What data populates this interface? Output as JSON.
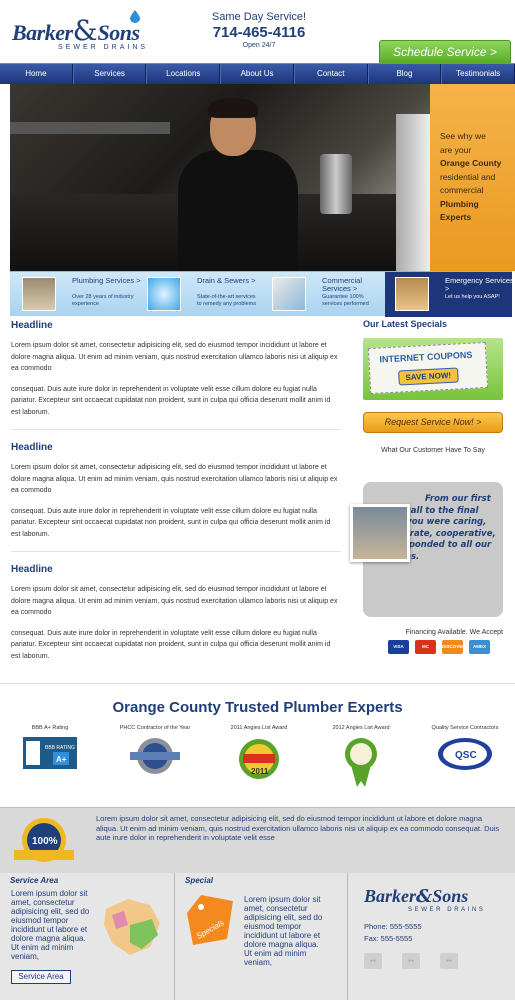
{
  "header": {
    "brand_first": "Barker",
    "brand_amp": "&",
    "brand_second": "Sons",
    "brand_sub": "SEWER DRAINS",
    "service_line": "Same Day Service!",
    "phone": "714-465-4116",
    "hours": "Open 24/7",
    "schedule_label": "Schedule Service >"
  },
  "nav": {
    "items": [
      "Home",
      "Services",
      "Locations",
      "About Us",
      "Contact",
      "Blog",
      "Testimonials"
    ]
  },
  "hero": {
    "promo_line1": "See why we",
    "promo_line2": "are your",
    "promo_line3": "Orange County",
    "promo_line4": "residential and",
    "promo_line5": "commercial",
    "promo_line6": "Plumbing",
    "promo_line7": "Experts"
  },
  "services": [
    {
      "title": "Plumbing Services >",
      "desc": "Over 28 years of industry experience"
    },
    {
      "title": "Drain & Sewers >",
      "desc": "State-of-the-art services to remedy any problems"
    },
    {
      "title": "Commercial Services >",
      "desc": "Guarantee 100% services performed"
    },
    {
      "title": "Emergency Services >",
      "desc": "Let us help you ASAP!"
    }
  ],
  "articles": [
    {
      "headline": "Headline",
      "p1": "Lorem ipsum dolor sit amet, consectetur adipisicing elit, sed do eiusmod tempor incididunt ut labore et dolore magna aliqua. Ut enim ad minim veniam, quis nostrud exercitation ullamco laboris nisi ut aliquip ex ea commodo",
      "p2": "consequat. Duis aute irure dolor in reprehenderit in voluptate velit esse cillum dolore eu fugiat nulla pariatur. Excepteur sint occaecat cupidatat non proident, sunt in culpa qui officia deserunt mollit anim id est laborum."
    },
    {
      "headline": "Headline",
      "p1": "Lorem ipsum dolor sit amet, consectetur adipisicing elit, sed do eiusmod tempor incididunt ut labore et dolore magna aliqua. Ut enim ad minim veniam, quis nostrud exercitation ullamco laboris nisi ut aliquip ex ea commodo",
      "p2": "consequat. Duis aute irure dolor in reprehenderit in voluptate velit esse cillum dolore eu fugiat nulla pariatur. Excepteur sint occaecat cupidatat non proident, sunt in culpa qui officia deserunt mollit anim id est laborum."
    },
    {
      "headline": "Headline",
      "p1": "Lorem ipsum dolor sit amet, consectetur adipisicing elit, sed do eiusmod tempor incididunt ut labore et dolore magna aliqua. Ut enim ad minim veniam, quis nostrud exercitation ullamco laboris nisi ut aliquip ex ea commodo",
      "p2": "consequat. Duis aute irure dolor in reprehenderit in voluptate velit esse cillum dolore eu fugiat nulla pariatur. Excepteur sint occaecat cupidatat non proident, sunt in culpa qui officia deserunt mollit anim id est laborum."
    }
  ],
  "sidebar": {
    "specials_title": "Our Latest Specials",
    "coupon_title": "INTERNET COUPONS",
    "coupon_cta": "SAVE NOW!",
    "request_label": "Request Service Now! >",
    "say_title": "What Our Customer Have To Say",
    "testimonial": "From our first phone call to the final patch, you were caring, considerate, cooperative, and responded to all our concerns.",
    "financing": "Financing Available. We Accept",
    "cards": [
      "VISA",
      "MC",
      "DISCOVER",
      "AMEX"
    ]
  },
  "trusted": {
    "title": "Orange County Trusted Plumber Experts",
    "badges": [
      {
        "label": "BBB A+ Rating",
        "text": "BBB RATING A+"
      },
      {
        "label": "PHCC Contractor of the Year",
        "text": "PHCC"
      },
      {
        "label": "2011 Angies List Award",
        "text": "2011"
      },
      {
        "label": "2012 Angies List Award",
        "text": "2012"
      },
      {
        "label": "Quality Service Contractors",
        "text": "QSC"
      }
    ]
  },
  "band": {
    "seal_text": "100%",
    "text": "Lorem ipsum dolor sit amet, consectetur adipisicing elit, sed do eiusmod tempor incididunt ut labore et dolore magna aliqua. Ut enim ad minim veniam, quis nostrud exercitation ullamco laboris nisi ut aliquip ex ea commodo consequat. Duis aute irure dolor in reprehenderit in voluptate velit esse"
  },
  "footer": {
    "area_title": "Service Area",
    "area_text": "Lorem ipsum dolor sit amet, consectetur adipisicing elit, sed do eiusmod tempor incididunt ut labore et dolore magna aliqua. Ut enim ad minim veniam,",
    "area_button": "Service Area",
    "special_title": "Special",
    "special_tag": "Specials",
    "special_text": "Lorem ipsum dolor sit amet, consectetur adipisicing elit, sed do eiusmod tempor incididunt ut labore et dolore magna aliqua. Ut enim ad minim veniam,",
    "phone": "Phone: 555-5555",
    "fax": "Fax: 555-5555"
  },
  "colors": {
    "brand_blue": "#1f3f7a",
    "accent_orange": "#e99a20",
    "accent_green": "#5aab2a"
  }
}
